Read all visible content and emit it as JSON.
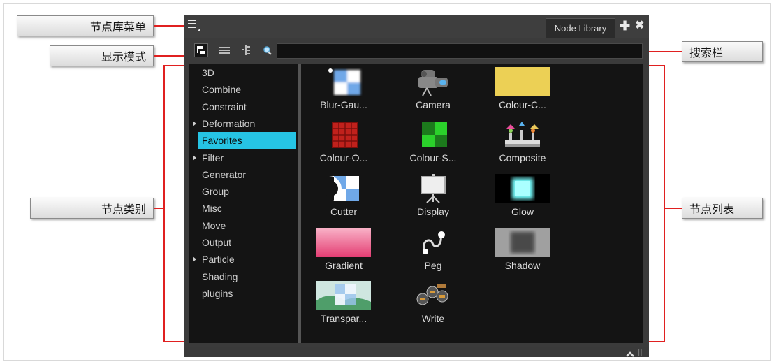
{
  "callouts": {
    "node_library_menu": "节点库菜单",
    "display_mode": "显示模式",
    "node_categories": "节点类别",
    "search_bar": "搜索栏",
    "node_list": "节点列表"
  },
  "panel": {
    "tab_label": "Node Library",
    "tab_add_symbol": "✚",
    "tab_close_symbol": "✖",
    "search_value": ""
  },
  "categories": [
    {
      "label": "3D",
      "expandable": false,
      "selected": false
    },
    {
      "label": "Combine",
      "expandable": false,
      "selected": false
    },
    {
      "label": "Constraint",
      "expandable": false,
      "selected": false
    },
    {
      "label": "Deformation",
      "expandable": true,
      "selected": false
    },
    {
      "label": "Favorites",
      "expandable": false,
      "selected": true
    },
    {
      "label": "Filter",
      "expandable": true,
      "selected": false
    },
    {
      "label": "Generator",
      "expandable": false,
      "selected": false
    },
    {
      "label": "Group",
      "expandable": false,
      "selected": false
    },
    {
      "label": "Misc",
      "expandable": false,
      "selected": false
    },
    {
      "label": "Move",
      "expandable": false,
      "selected": false
    },
    {
      "label": "Output",
      "expandable": false,
      "selected": false
    },
    {
      "label": "Particle",
      "expandable": true,
      "selected": false
    },
    {
      "label": "Shading",
      "expandable": false,
      "selected": false
    },
    {
      "label": "plugins",
      "expandable": false,
      "selected": false
    }
  ],
  "nodes": [
    {
      "label": "Blur-Gau...",
      "icon": "blur-gaussian-icon"
    },
    {
      "label": "Camera",
      "icon": "camera-icon"
    },
    {
      "label": "Colour-C...",
      "icon": "colour-card-icon"
    },
    {
      "label": "Colour-O...",
      "icon": "colour-override-icon"
    },
    {
      "label": "Colour-S...",
      "icon": "colour-scale-icon"
    },
    {
      "label": "Composite",
      "icon": "composite-icon"
    },
    {
      "label": "Cutter",
      "icon": "cutter-icon"
    },
    {
      "label": "Display",
      "icon": "display-icon"
    },
    {
      "label": "Glow",
      "icon": "glow-icon"
    },
    {
      "label": "Gradient",
      "icon": "gradient-icon"
    },
    {
      "label": "Peg",
      "icon": "peg-icon"
    },
    {
      "label": "Shadow",
      "icon": "shadow-icon"
    },
    {
      "label": "Transpar...",
      "icon": "transparency-icon"
    },
    {
      "label": "Write",
      "icon": "write-icon"
    }
  ],
  "colors": {
    "callout_line": "#e02020",
    "selection": "#26c4e4",
    "panel_bg": "#3b3b3b",
    "list_bg": "#141414",
    "colour_card": "#ecd055"
  }
}
